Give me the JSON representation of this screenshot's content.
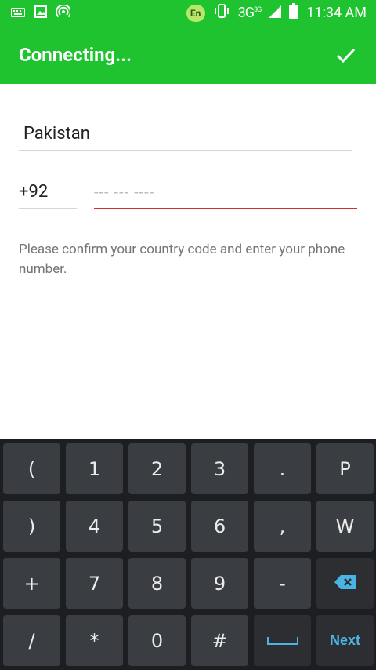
{
  "status_bar": {
    "en_badge": "En",
    "network": "3G",
    "network_sup": "3G",
    "time": "11:34 AM",
    "icons": [
      "keyboard-icon",
      "image-icon",
      "hotspot-icon",
      "vibrate-icon",
      "signal-icon",
      "battery-icon"
    ]
  },
  "app_bar": {
    "title": "Connecting...",
    "confirm_icon": "check-icon"
  },
  "form": {
    "country": "Pakistan",
    "country_code": "+92",
    "phone_placeholder": "--- --- ----",
    "help_text": "Please confirm your country code and enter your phone number."
  },
  "keyboard": {
    "rows": [
      [
        "(",
        "1",
        "2",
        "3",
        ".",
        "P"
      ],
      [
        ")",
        "4",
        "5",
        "6",
        ",",
        "W"
      ],
      [
        "+",
        "7",
        "8",
        "9",
        "-",
        "backspace"
      ],
      [
        "/",
        "*",
        "0",
        "#",
        "space",
        "Next"
      ]
    ]
  },
  "colors": {
    "accent_green": "#1fc32f",
    "error_red": "#d32f2f",
    "key_blue": "#4bb4e6"
  }
}
